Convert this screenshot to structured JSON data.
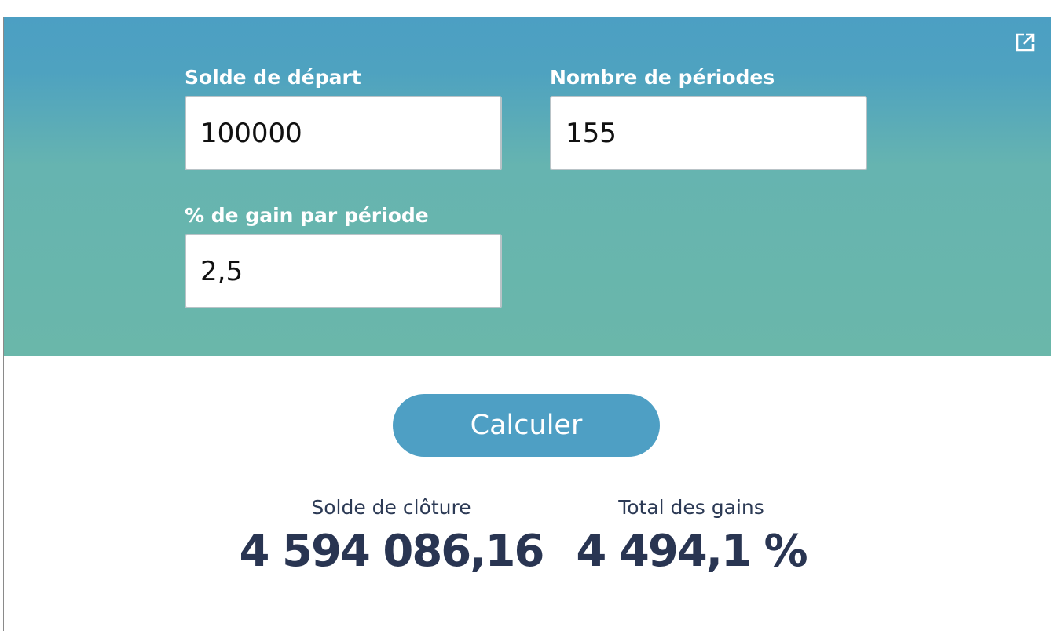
{
  "form": {
    "start_balance": {
      "label": "Solde de départ",
      "value": "100000"
    },
    "periods": {
      "label": "Nombre de périodes",
      "value": "155"
    },
    "gain_percent": {
      "label": "% de gain par période",
      "value": "2,5"
    }
  },
  "actions": {
    "calculate_label": "Calculer",
    "open_external_icon": "external-link-icon"
  },
  "results": {
    "closing_balance": {
      "label": "Solde de clôture",
      "value": "4 594 086,16"
    },
    "total_gains": {
      "label": "Total des gains",
      "value": "4 494,1 %"
    }
  },
  "colors": {
    "panel_top": "#4c9fc3",
    "panel_bottom": "#6ab7aa",
    "button": "#4e9fc4",
    "result_text": "#293552"
  }
}
